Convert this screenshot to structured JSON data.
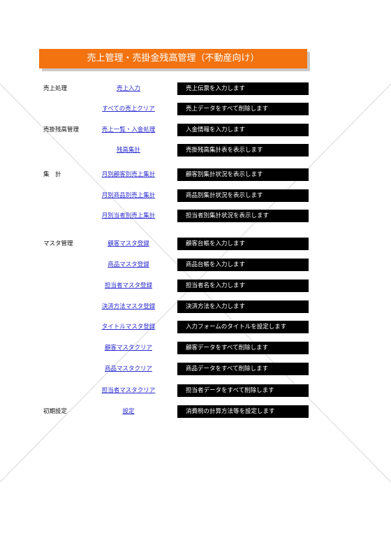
{
  "title": "売上管理・売掛金残高管理（不動産向け）",
  "sections": [
    {
      "label": "売上処理"
    },
    {
      "label": "売掛残高管理"
    },
    {
      "label": "集　計"
    },
    {
      "label": "マスタ管理"
    },
    {
      "label": "初期設定"
    }
  ],
  "menu": [
    {
      "link": "売上入力",
      "desc": "売上伝票を入力します"
    },
    {
      "link": "すべての売上クリア",
      "desc": "売上データをすべて削除します"
    },
    {
      "link": "売上一覧・入金処理",
      "desc": "入金情報を入力します"
    },
    {
      "link": "残高集計",
      "desc": "売掛残高集計表を表示します"
    },
    {
      "link": "月別顧客別売上集計",
      "desc": "顧客別集計状況を表示します"
    },
    {
      "link": "月別商品別売上集計",
      "desc": "商品別集計状況を表示します"
    },
    {
      "link": "月別当者別売上集計",
      "desc": "担当者別集計状況を表示します"
    },
    {
      "link": "顧客マスタ登録",
      "desc": "顧客台帳を入力します"
    },
    {
      "link": "商品マスタ登録",
      "desc": "商品台帳を入力します"
    },
    {
      "link": "担当者マスタ登録",
      "desc": "担当者名を入力します"
    },
    {
      "link": "決済方法マスタ登録",
      "desc": "決済方法を入力します"
    },
    {
      "link": "タイトルマスタ登録",
      "desc": "入力フォームのタイトルを設定します"
    },
    {
      "link": "顧客マスタクリア",
      "desc": "顧客データをすべて削除します"
    },
    {
      "link": "商品マスタクリア",
      "desc": "商品データをすべて削除します"
    },
    {
      "link": "担当者マスタクリア",
      "desc": "担当者データをすべて削除します"
    },
    {
      "link": "設定",
      "desc": "消費税の計算方法等を設定します"
    }
  ],
  "colors": {
    "title_bg": "#f27310",
    "link": "#2a2ad0",
    "desc_bg": "#000000"
  }
}
